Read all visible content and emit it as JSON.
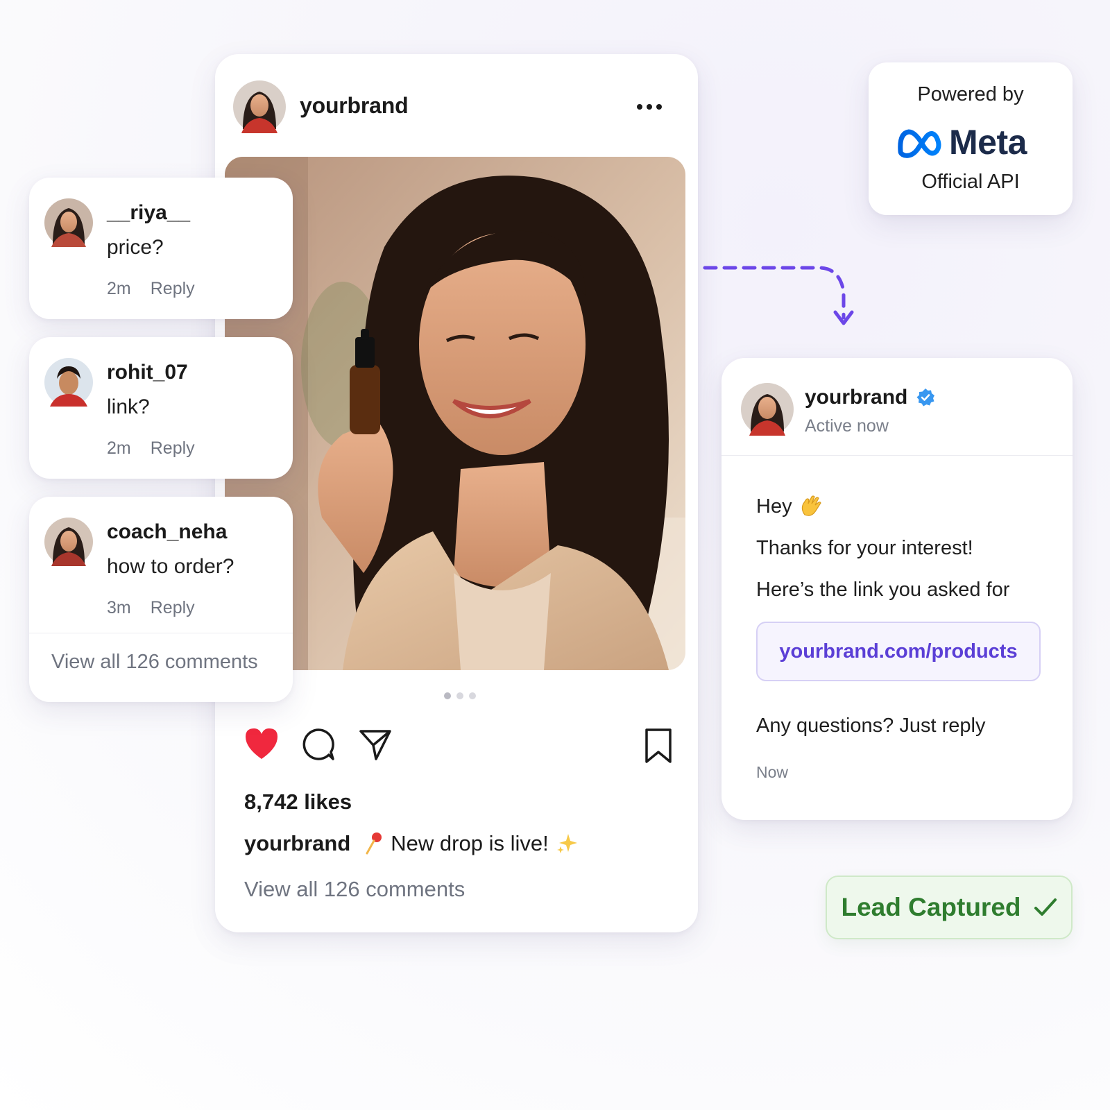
{
  "post": {
    "username": "yourbrand",
    "likes": "8,742 likes",
    "caption_user": "yourbrand",
    "caption_text": "New drop is live!",
    "view_all": "View all 126 comments"
  },
  "comments": [
    {
      "user": "__riya__",
      "text": "price?",
      "time": "2m",
      "reply": "Reply"
    },
    {
      "user": "rohit_07",
      "text": "link?",
      "time": "2m",
      "reply": "Reply"
    },
    {
      "user": "coach_neha",
      "text": "how to order?",
      "time": "3m",
      "reply": "Reply"
    }
  ],
  "comments_view_all": "View all 126 comments",
  "meta_badge": {
    "powered_by": "Powered by",
    "brand": "Meta",
    "api": "Official API"
  },
  "dm": {
    "username": "yourbrand",
    "status": "Active now",
    "greeting": "Hey",
    "line2": "Thanks for your interest!",
    "line3": "Here’s the link you asked for",
    "link": "yourbrand.com/products",
    "line4": "Any questions? Just reply",
    "time": "Now"
  },
  "lead": {
    "label": "Lead Captured"
  },
  "colors": {
    "accent": "#6c47e8",
    "like": "#f0283e",
    "meta_blue": "#0866ff",
    "lead_green": "#2f7d2f"
  },
  "icons": [
    "more-icon",
    "heart-icon",
    "comment-icon",
    "share-icon",
    "bookmark-icon",
    "verified-icon",
    "wave-icon",
    "pin-icon",
    "sparkle-icon",
    "meta-infinity-icon",
    "check-icon",
    "arrow-icon"
  ]
}
